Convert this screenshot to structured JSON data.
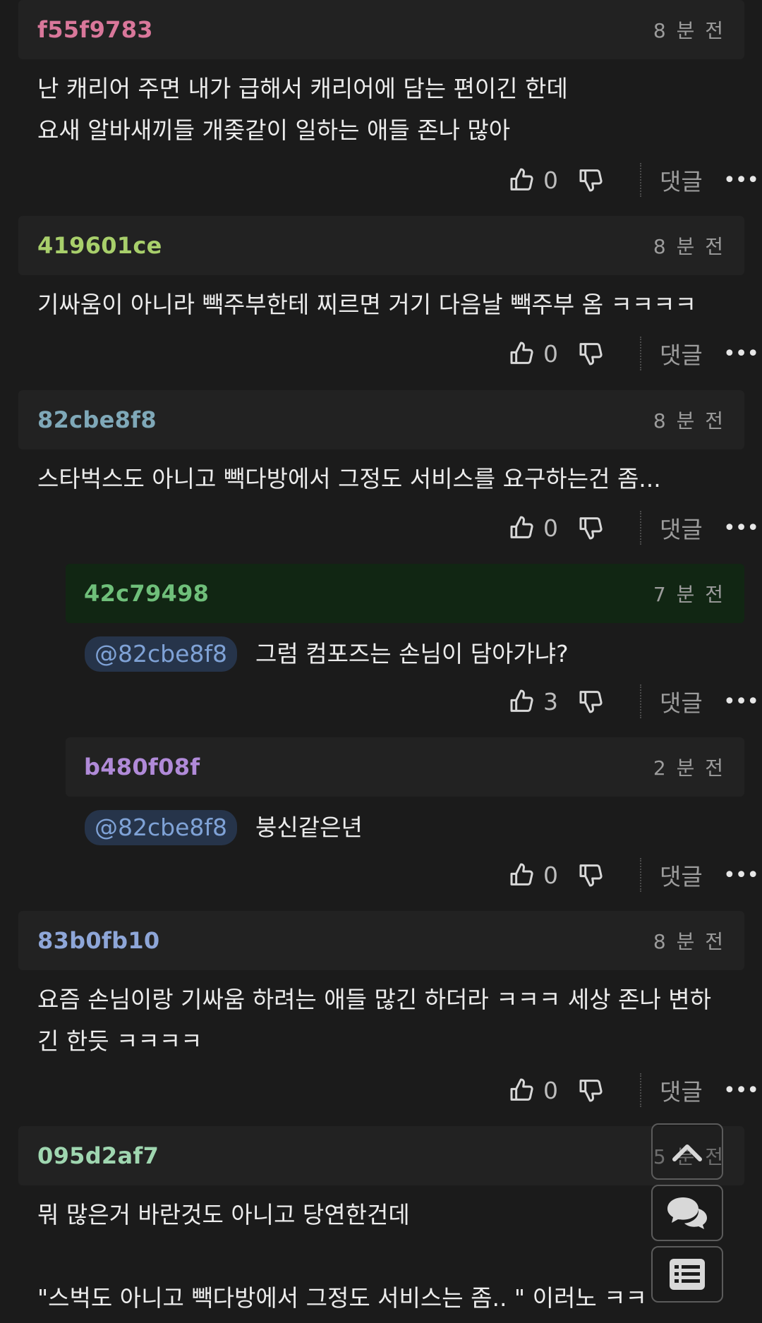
{
  "comments": [
    {
      "author": "f55f9783",
      "author_color": "#d9779a",
      "time": "8 분 전",
      "lines": [
        "난 캐리어 주면 내가 급해서 캐리어에 담는 편이긴 한데",
        "요새 알바새끼들 개좆같이 일하는 애들 존나 많아"
      ],
      "likes": "0",
      "reply_label": "댓글"
    },
    {
      "author": "419601ce",
      "author_color": "#a8cf6b",
      "time": "8 분 전",
      "lines": [
        "기싸움이 아니라 빽주부한테 찌르면 거기 다음날 빽주부 옴 ㅋㅋㅋㅋ"
      ],
      "likes": "0",
      "reply_label": "댓글"
    },
    {
      "author": "82cbe8f8",
      "author_color": "#7fa8b8",
      "time": "8 분 전",
      "lines": [
        "스타벅스도 아니고 빽다방에서 그정도 서비스를 요구하는건 좀..."
      ],
      "likes": "0",
      "reply_label": "댓글"
    },
    {
      "author": "42c79498",
      "author_color": "#6fbf7a",
      "time": "7 분 전",
      "mention": "@82cbe8f8",
      "lines": [
        "그럼 컴포즈는 손님이 담아가냐?"
      ],
      "likes": "3",
      "reply_label": "댓글"
    },
    {
      "author": "b480f08f",
      "author_color": "#b08ad8",
      "time": "2 분 전",
      "mention": "@82cbe8f8",
      "lines": [
        "붕신같은년"
      ],
      "likes": "0",
      "reply_label": "댓글"
    },
    {
      "author": "83b0fb10",
      "author_color": "#8ea6d8",
      "time": "8 분 전",
      "lines": [
        "요즘 손님이랑 기싸움 하려는 애들 많긴 하더라 ㅋㅋㅋ 세상 존나 변하",
        "긴 한듯 ㅋㅋㅋㅋ"
      ],
      "likes": "0",
      "reply_label": "댓글"
    },
    {
      "author": "095d2af7",
      "author_color": "#9fd6b0",
      "time": "5 분 전",
      "lines": [
        "뭐 많은거 바란것도 아니고 당연한건데",
        "",
        "\"스벅도 아니고 빽다방에서 그정도 서비스는 좀.. \" 이러노 ㅋㅋ"
      ]
    }
  ],
  "more_label": "•••",
  "floating": {
    "top_icon": "chevron-up-icon",
    "chat_icon": "chat-bubbles-icon",
    "list_icon": "list-icon"
  }
}
